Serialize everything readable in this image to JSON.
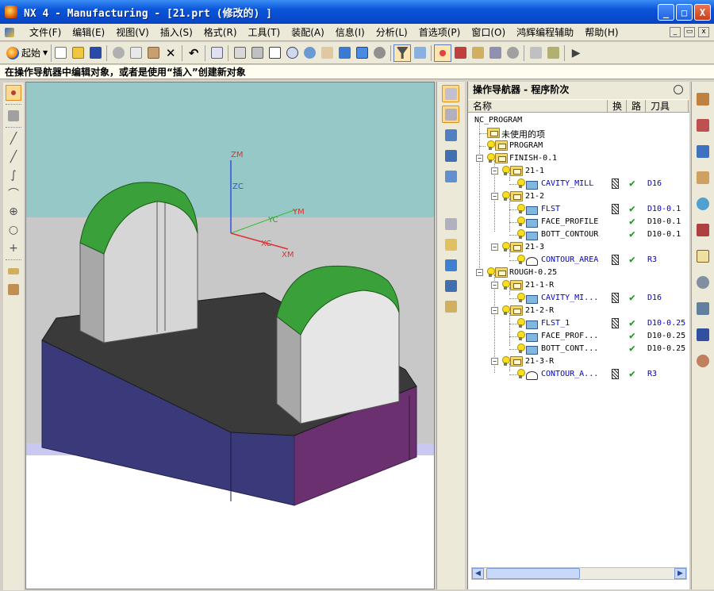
{
  "window": {
    "title": "NX 4 - Manufacturing - [21.prt (修改的) ]",
    "buttons": [
      "_",
      "□",
      "X"
    ]
  },
  "menubar": {
    "items": [
      "文件(F)",
      "编辑(E)",
      "视图(V)",
      "插入(S)",
      "格式(R)",
      "工具(T)",
      "装配(A)",
      "信息(I)",
      "分析(L)",
      "首选项(P)",
      "窗口(O)",
      "鸿辉编程辅助",
      "帮助(H)"
    ]
  },
  "toolbar": {
    "start_label": "起始"
  },
  "status": {
    "prompt": "在操作导航器中编辑对象，或者是使用“插入”创建新对象"
  },
  "viewport": {
    "axes": {
      "zm": "ZM",
      "zc": "ZC",
      "ym": "YM",
      "yc": "YC",
      "xc": "XC",
      "xm": "XM"
    },
    "colors": {
      "background_top": "#96c8c8",
      "background_mid": "#c8c8c8",
      "background_bottom": "#ffffff",
      "model_top": "#3a3a3a",
      "model_side_front": "#3a3a7a",
      "model_side_right": "#6a3070",
      "boss_face": "#cfcfcf",
      "boss_top": "#3aa03a"
    }
  },
  "navigator": {
    "title": "操作导航器 - 程序阶次",
    "columns": [
      "名称",
      "换",
      "路",
      "刀具"
    ],
    "rows": [
      {
        "name": "NC_PROGRAM",
        "tool": ""
      },
      {
        "name": "未使用的项",
        "tool": ""
      },
      {
        "name": "PROGRAM",
        "tool": ""
      },
      {
        "name": "FINISH-0.1",
        "tool": ""
      },
      {
        "name": "21-1",
        "tool": ""
      },
      {
        "name": "CAVITY_MILL",
        "tool": "D16"
      },
      {
        "name": "21-2",
        "tool": ""
      },
      {
        "name": "FLST",
        "tool": "D10-0.1"
      },
      {
        "name": "FACE_PROFILE",
        "tool": "D10-0.1"
      },
      {
        "name": "BOTT_CONTOUR",
        "tool": "D10-0.1"
      },
      {
        "name": "21-3",
        "tool": ""
      },
      {
        "name": "CONTOUR_AREA",
        "tool": "R3"
      },
      {
        "name": "ROUGH-0.25",
        "tool": ""
      },
      {
        "name": "21-1-R",
        "tool": ""
      },
      {
        "name": "CAVITY_MI...",
        "tool": "D16"
      },
      {
        "name": "21-2-R",
        "tool": ""
      },
      {
        "name": "FLST_1",
        "tool": "D10-0.25"
      },
      {
        "name": "FACE_PROF...",
        "tool": "D10-0.25"
      },
      {
        "name": "BOTT_CONT...",
        "tool": "D10-0.25"
      },
      {
        "name": "21-3-R",
        "tool": ""
      },
      {
        "name": "CONTOUR_A...",
        "tool": "R3"
      }
    ]
  }
}
